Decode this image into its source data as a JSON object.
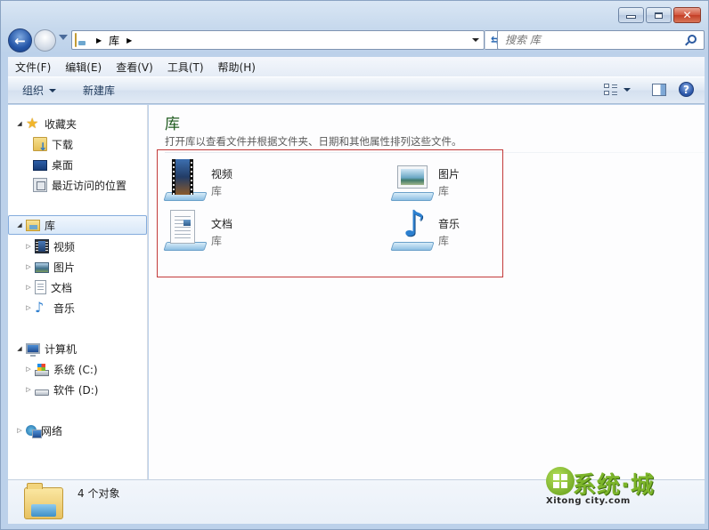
{
  "window": {
    "caption_buttons": {
      "minimize": "minimize",
      "maximize": "maximize",
      "close": "✕"
    }
  },
  "navigation": {
    "breadcrumb": [
      {
        "label": "库"
      }
    ],
    "search": {
      "placeholder": "搜索 库",
      "value": ""
    }
  },
  "menu": {
    "items": [
      {
        "label": "文件(F)"
      },
      {
        "label": "编辑(E)"
      },
      {
        "label": "查看(V)"
      },
      {
        "label": "工具(T)"
      },
      {
        "label": "帮助(H)"
      }
    ]
  },
  "toolbar": {
    "organize_label": "组织",
    "new_library_label": "新建库"
  },
  "sidebar": {
    "favorites": {
      "label": "收藏夹",
      "items": [
        {
          "label": "下载",
          "icon": "download-folder-icon"
        },
        {
          "label": "桌面",
          "icon": "desktop-icon"
        },
        {
          "label": "最近访问的位置",
          "icon": "recent-places-icon"
        }
      ]
    },
    "libraries": {
      "label": "库",
      "selected": true,
      "items": [
        {
          "label": "视频",
          "icon": "video-library-icon"
        },
        {
          "label": "图片",
          "icon": "picture-library-icon"
        },
        {
          "label": "文档",
          "icon": "document-library-icon"
        },
        {
          "label": "音乐",
          "icon": "music-library-icon"
        }
      ]
    },
    "computer": {
      "label": "计算机",
      "items": [
        {
          "label": "系统 (C:)",
          "icon": "system-drive-icon"
        },
        {
          "label": "软件 (D:)",
          "icon": "drive-icon"
        }
      ]
    },
    "network": {
      "label": "网络"
    }
  },
  "content": {
    "title": "库",
    "description": "打开库以查看文件并根据文件夹、日期和其他属性排列这些文件。",
    "libraries": [
      {
        "name": "视频",
        "type": "库"
      },
      {
        "name": "图片",
        "type": "库"
      },
      {
        "name": "文档",
        "type": "库"
      },
      {
        "name": "音乐",
        "type": "库"
      }
    ]
  },
  "details": {
    "count_text": "4 个对象"
  },
  "watermark": {
    "title": "系统·城",
    "subtitle": "Xitong city.com"
  },
  "colors": {
    "title_green": "#1e5a1e",
    "highlight_red": "#c33a3a",
    "selection_border": "#84acdd"
  }
}
